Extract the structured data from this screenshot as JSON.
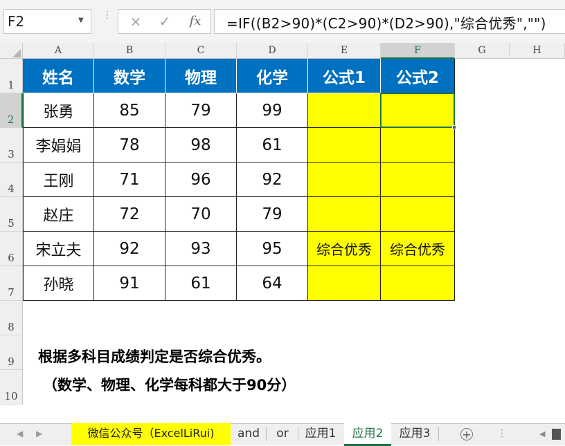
{
  "formula_bar": {
    "name_box": "F2",
    "cancel_icon": "×",
    "enter_icon": "✓",
    "fx_label": "fx",
    "formula": "=IF((B2>90)*(C2>90)*(D2>90),\"综合优秀\",\"\")"
  },
  "columns": [
    "A",
    "B",
    "C",
    "D",
    "E",
    "F",
    "G",
    "H"
  ],
  "rows": [
    "1",
    "2",
    "3",
    "4",
    "5",
    "6",
    "7",
    "8",
    "9",
    "10"
  ],
  "selected_cell": {
    "column": "F",
    "row": "2"
  },
  "table": {
    "headers": [
      "姓名",
      "数学",
      "物理",
      "化学",
      "公式1",
      "公式2"
    ],
    "rows": [
      [
        "张勇",
        "85",
        "79",
        "99",
        "",
        ""
      ],
      [
        "李娟娟",
        "78",
        "98",
        "61",
        "",
        ""
      ],
      [
        "王刚",
        "71",
        "96",
        "92",
        "",
        ""
      ],
      [
        "赵庄",
        "72",
        "70",
        "79",
        "",
        ""
      ],
      [
        "宋立夫",
        "92",
        "93",
        "95",
        "综合优秀",
        "综合优秀"
      ],
      [
        "孙晓",
        "91",
        "61",
        "64",
        "",
        ""
      ]
    ]
  },
  "notes": {
    "line1": "根据多科目成绩判定是否综合优秀。",
    "line2": "（数学、物理、化学每科都大于90分）"
  },
  "sheet_tabs": {
    "wechat": "微信公众号（ExcelLiRui)",
    "tabs": [
      "and",
      "or",
      "应用1",
      "应用2",
      "应用3"
    ],
    "active": "应用2",
    "add_icon": "+"
  },
  "colors": {
    "header_fill": "#0070c0",
    "highlight_fill": "#ffff00",
    "selection": "#217346"
  }
}
